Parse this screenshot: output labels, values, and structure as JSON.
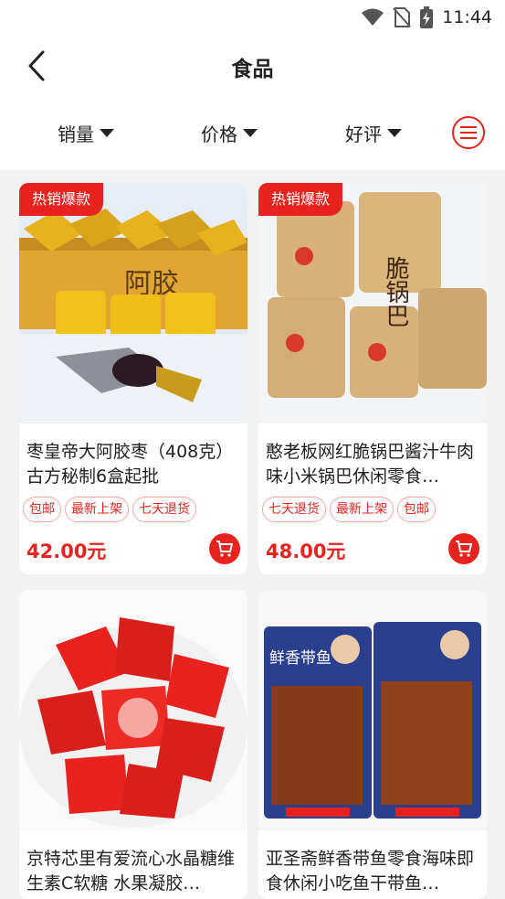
{
  "status": {
    "time": "11:44"
  },
  "header": {
    "title": "食品"
  },
  "filters": [
    {
      "label": "销量"
    },
    {
      "label": "价格"
    },
    {
      "label": "好评"
    }
  ],
  "products": [
    {
      "badge": "热销爆款",
      "title": "枣皇帝大阿胶枣（408克）古方秘制6盒起批",
      "tags": [
        "包邮",
        "最新上架",
        "七天退货"
      ],
      "price": "42.00元",
      "image_text": "阿胶"
    },
    {
      "badge": "热销爆款",
      "title": "憨老板网红脆锅巴酱汁牛肉味小米锅巴休闲零食…",
      "tags": [
        "七天退货",
        "最新上架",
        "包邮"
      ],
      "price": "48.00元",
      "image_text": "脆锅巴"
    },
    {
      "badge": "",
      "title": "京特芯里有爱流心水晶糖维生素C软糖 水果凝胶…",
      "tags": [],
      "price": "",
      "image_text": ""
    },
    {
      "badge": "",
      "title": "亚圣斋鲜香带鱼零食海味即食休闲小吃鱼干带鱼…",
      "tags": [],
      "price": "",
      "image_text": "鲜香带鱼"
    }
  ],
  "colors": {
    "accent": "#e8231f",
    "background": "#f2f2f2"
  }
}
